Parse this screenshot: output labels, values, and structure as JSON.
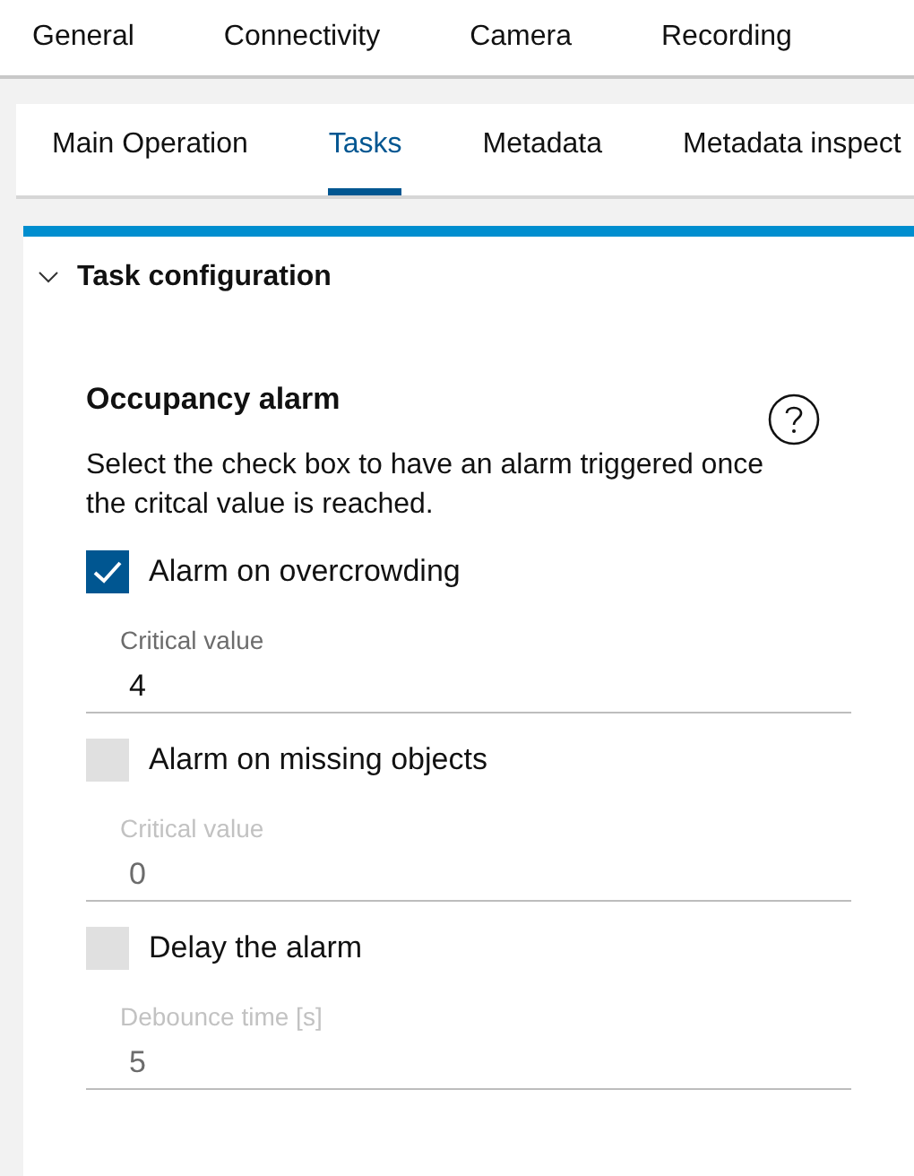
{
  "main_tabs": [
    {
      "label": "General",
      "selected": false
    },
    {
      "label": "Connectivity",
      "selected": false
    },
    {
      "label": "Camera",
      "selected": false
    },
    {
      "label": "Recording",
      "selected": false
    }
  ],
  "sub_tabs": [
    {
      "label": "Main Operation",
      "selected": false
    },
    {
      "label": "Tasks",
      "selected": true
    },
    {
      "label": "Metadata",
      "selected": false
    },
    {
      "label": "Metadata inspect",
      "selected": false
    }
  ],
  "section": {
    "title": "Task configuration",
    "expanded": true
  },
  "group": {
    "title": "Occupancy alarm",
    "description": "Select the check box to have an alarm triggered once the critcal value is reached.",
    "options": [
      {
        "label": "Alarm on overcrowding",
        "checked": true,
        "field": {
          "label": "Critical value",
          "value": "4",
          "disabled": false
        }
      },
      {
        "label": "Alarm on missing objects",
        "checked": false,
        "field": {
          "label": "Critical value",
          "value": "0",
          "disabled": true
        }
      },
      {
        "label": "Delay the alarm",
        "checked": false,
        "field": {
          "label": "Debounce time [s]",
          "value": "5",
          "disabled": true
        }
      }
    ]
  }
}
